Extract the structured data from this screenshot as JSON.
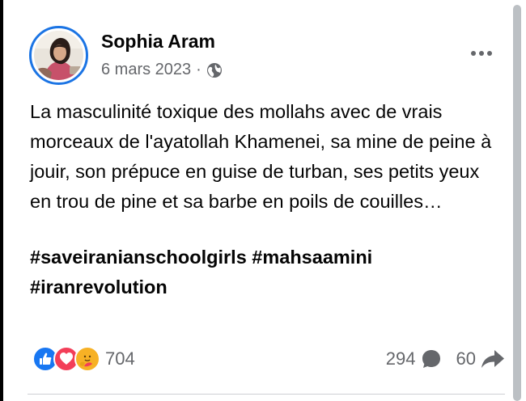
{
  "post": {
    "author": "Sophia Aram",
    "date": "6 mars 2023",
    "separator": "·",
    "privacy_icon": "globe-icon",
    "text": "La masculinité toxique des mollahs avec de vrais morceaux de l'ayatollah Khamenei, sa mine de peine à jouir, son prépuce en guise de turban, ses petits yeux en trou de pine et sa barbe en poils de couilles…",
    "hashtags": [
      "#saveiranianschoolgirls",
      "#mahsaamini",
      "#iranrevolution"
    ]
  },
  "reactions": {
    "icons": [
      "like-icon",
      "love-icon",
      "care-icon"
    ],
    "count": "704"
  },
  "stats": {
    "comments": "294",
    "comments_icon": "comment-icon",
    "shares": "60",
    "shares_icon": "share-icon"
  },
  "colors": {
    "accent": "#1b74e4",
    "like": "#1877f2",
    "love": "#f33e58",
    "care": "#f7b125",
    "secondary_text": "#65676b"
  }
}
